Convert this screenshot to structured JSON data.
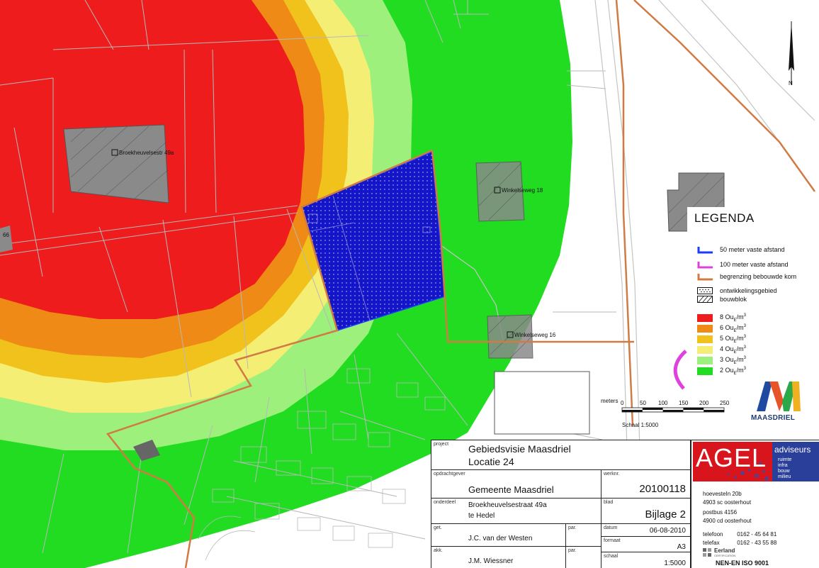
{
  "map": {
    "labels": {
      "broekheuvel": "Broekheuvelsestr 49a",
      "winkelse18": "Winkelseweg 18",
      "winkelse16": "Winkelseweg 16",
      "left_edge": "66",
      "north": "N"
    },
    "scalebar": {
      "unit_label": "meters",
      "ticks": [
        "0",
        "50",
        "100",
        "150",
        "200",
        "250"
      ],
      "scale_text": "Schaal 1:5000"
    }
  },
  "legend": {
    "title": "LEGENDA",
    "items": [
      {
        "label": "50 meter vaste afstand",
        "color": "#1a3cff"
      },
      {
        "label": "100 meter vaste afstand",
        "color": "#e040e0"
      },
      {
        "label": "begrenzing bebouwde kom",
        "color": "#d07a44"
      },
      {
        "label": "ontwikkelingsgebied",
        "color": "#1515c8"
      },
      {
        "label": "bouwblok",
        "color": "#333333"
      }
    ],
    "odour": [
      {
        "value": "8",
        "color": "#ee1c1c"
      },
      {
        "value": "6",
        "color": "#ef8a16"
      },
      {
        "value": "5",
        "color": "#f1c21b"
      },
      {
        "value": "4",
        "color": "#f4ef74"
      },
      {
        "value": "3",
        "color": "#9df07c"
      },
      {
        "value": "2",
        "color": "#22dc22"
      }
    ],
    "odour_unit_prefix": "Ou",
    "odour_unit_sub": "E",
    "odour_unit_suffix": "/m",
    "odour_unit_sup": "3"
  },
  "logo": {
    "text": "MAASDRIEL"
  },
  "titleblock": {
    "project_caption": "project",
    "project_line1": "Gebiedsvisie Maasdriel",
    "project_line2": "Locatie 24",
    "client_caption": "opdrachtgever",
    "client": "Gemeente Maasdriel",
    "workno_caption": "werknr.",
    "workno": "20100118",
    "part_caption": "onderdeel",
    "part_line1": "Broekheuvelsestraat 49a",
    "part_line2": "te Hedel",
    "sheet_caption": "blad",
    "sheet": "Bijlage 2",
    "drawn_caption": "get.",
    "drawn": "J.C. van der Westen",
    "par_caption": "par.",
    "date_caption": "datum",
    "date": "06-08-2010",
    "format_caption": "formaat",
    "format": "A3",
    "approved_caption": "akk.",
    "approved": "J.M. Wiessner",
    "scale_caption": "schaal",
    "scale": "1:5000"
  },
  "agel": {
    "name": "AGEL",
    "adviseurs": "adviseurs",
    "tags": [
      "ruimte",
      "infra",
      "bouw",
      "milieu"
    ],
    "address": [
      "hoevesteIn 20b",
      "4903 sc oosterhout",
      "postbus 4156",
      "4900 cd oosterhout"
    ],
    "phone_label": "telefoon",
    "phone": "0162 - 45 64 81",
    "fax_label": "telefax",
    "fax": "0162 - 43 55 88",
    "cert_name": "Eerland",
    "cert_sub": "CERTIFICATION",
    "iso": "NEN-EN ISO 9001"
  }
}
